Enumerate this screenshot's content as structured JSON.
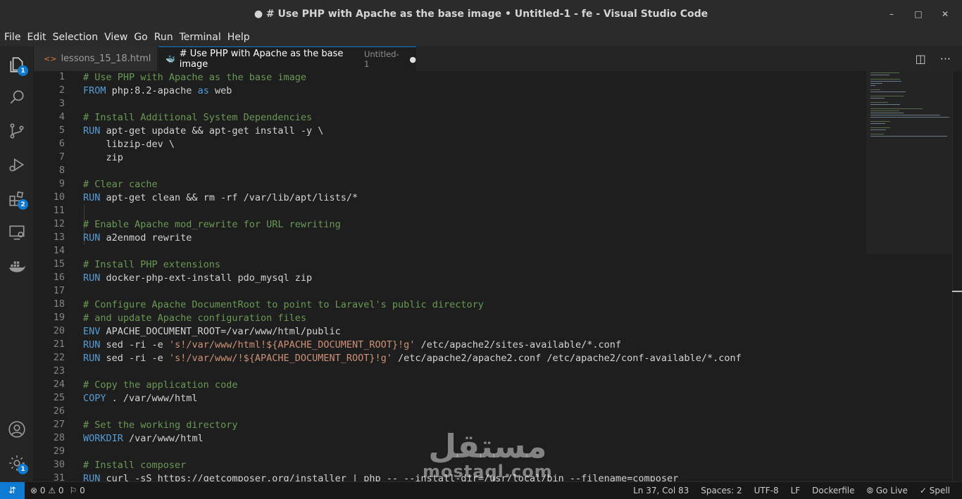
{
  "window": {
    "title": "● # Use PHP with Apache as the base image • Untitled-1 - fe - Visual Studio Code",
    "minimize_glyph": "–",
    "maximize_glyph": "□",
    "close_glyph": "✕"
  },
  "menu": [
    "File",
    "Edit",
    "Selection",
    "View",
    "Go",
    "Run",
    "Terminal",
    "Help"
  ],
  "activity_bar": [
    {
      "icon": "explorer-icon",
      "badge": "1"
    },
    {
      "icon": "search-icon",
      "badge": ""
    },
    {
      "icon": "source-control-icon",
      "badge": ""
    },
    {
      "icon": "run-debug-icon",
      "badge": ""
    },
    {
      "icon": "extensions-icon",
      "badge": "2"
    },
    {
      "icon": "remote-explorer-icon",
      "badge": ""
    },
    {
      "icon": "docker-icon",
      "badge": ""
    },
    {
      "icon": "account-icon",
      "badge": ""
    },
    {
      "icon": "manage-gear-icon",
      "badge": "1"
    }
  ],
  "tabs": [
    {
      "label": "lessons_15_18.html",
      "icon_glyph": "<>",
      "icon": "html-file-icon",
      "description": "",
      "active": false
    },
    {
      "label": "# Use PHP with Apache as the base image",
      "icon_glyph": "🐳",
      "icon": "docker-file-icon",
      "description": "Untitled-1",
      "active": true,
      "dirty_glyph": "●"
    }
  ],
  "editor_actions": [
    {
      "icon": "split-editor-icon",
      "glyph": "◫"
    },
    {
      "icon": "more-actions-icon",
      "glyph": "···"
    }
  ],
  "code_lines": [
    [
      {
        "t": "# Use PHP with Apache as the base image",
        "c": "cm"
      }
    ],
    [
      {
        "t": "FROM",
        "c": "kw"
      },
      {
        "t": " php:8.2-apache "
      },
      {
        "t": "as",
        "c": "kw"
      },
      {
        "t": " web"
      }
    ],
    [],
    [
      {
        "t": "# Install Additional System Dependencies",
        "c": "cm"
      }
    ],
    [
      {
        "t": "RUN",
        "c": "kw"
      },
      {
        "t": " apt-get update && apt-get install -y \\"
      }
    ],
    [
      {
        "t": "    libzip-dev \\"
      }
    ],
    [
      {
        "t": "    zip"
      }
    ],
    [],
    [
      {
        "t": "# Clear cache",
        "c": "cm"
      }
    ],
    [
      {
        "t": "RUN",
        "c": "kw"
      },
      {
        "t": " apt-get clean && rm -rf /var/lib/apt/lists/*"
      }
    ],
    [],
    [
      {
        "t": "# Enable Apache mod_rewrite for URL rewriting",
        "c": "cm"
      }
    ],
    [
      {
        "t": "RUN",
        "c": "kw"
      },
      {
        "t": " a2enmod rewrite"
      }
    ],
    [],
    [
      {
        "t": "# Install PHP extensions",
        "c": "cm"
      }
    ],
    [
      {
        "t": "RUN",
        "c": "kw"
      },
      {
        "t": " docker-php-ext-install pdo_mysql zip"
      }
    ],
    [],
    [
      {
        "t": "# Configure Apache DocumentRoot to point to Laravel's public directory",
        "c": "cm"
      }
    ],
    [
      {
        "t": "# and update Apache configuration files",
        "c": "cm"
      }
    ],
    [
      {
        "t": "ENV",
        "c": "kw"
      },
      {
        "t": " APACHE_DOCUMENT_ROOT=/var/www/html/public"
      }
    ],
    [
      {
        "t": "RUN",
        "c": "kw"
      },
      {
        "t": " sed -ri -e "
      },
      {
        "t": "'s!/var/www/html!${APACHE_DOCUMENT_ROOT}!g'",
        "c": "st"
      },
      {
        "t": " /etc/apache2/sites-available/*.conf"
      }
    ],
    [
      {
        "t": "RUN",
        "c": "kw"
      },
      {
        "t": " sed -ri -e "
      },
      {
        "t": "'s!/var/www/!${APACHE_DOCUMENT_ROOT}!g'",
        "c": "st"
      },
      {
        "t": " /etc/apache2/apache2.conf /etc/apache2/conf-available/*.conf"
      }
    ],
    [],
    [
      {
        "t": "# Copy the application code",
        "c": "cm"
      }
    ],
    [
      {
        "t": "COPY",
        "c": "kw"
      },
      {
        "t": " . /var/www/html"
      }
    ],
    [],
    [
      {
        "t": "# Set the working directory",
        "c": "cm"
      }
    ],
    [
      {
        "t": "WORKDIR",
        "c": "kw"
      },
      {
        "t": " /var/www/html"
      }
    ],
    [],
    [
      {
        "t": "# Install composer",
        "c": "cm"
      }
    ],
    [
      {
        "t": "RUN",
        "c": "kw"
      },
      {
        "t": " curl -sS https://getcomposer.org/installer | php -- --install-dir=/usr/local/bin --filename=composer"
      }
    ]
  ],
  "watermark": {
    "arabic": "مستقل",
    "latin": "mostaql.com"
  },
  "status_left": [
    {
      "icon": "remote-indicator-icon",
      "glyph": "⇵"
    },
    {
      "icon": "problems-icon",
      "text": "⊗ 0 ⚠ 0"
    },
    {
      "icon": "ports-icon",
      "text": "⚐ 0"
    }
  ],
  "status_right": [
    {
      "name": "cursor-position",
      "text": "Ln 37, Col 83"
    },
    {
      "name": "indentation",
      "text": "Spaces: 2"
    },
    {
      "name": "encoding",
      "text": "UTF-8"
    },
    {
      "name": "line-ending",
      "text": "LF"
    },
    {
      "name": "language-mode",
      "text": "Dockerfile"
    },
    {
      "name": "go-live",
      "text": "⦾ Go Live"
    },
    {
      "name": "spell",
      "text": "✓ Spell"
    }
  ]
}
